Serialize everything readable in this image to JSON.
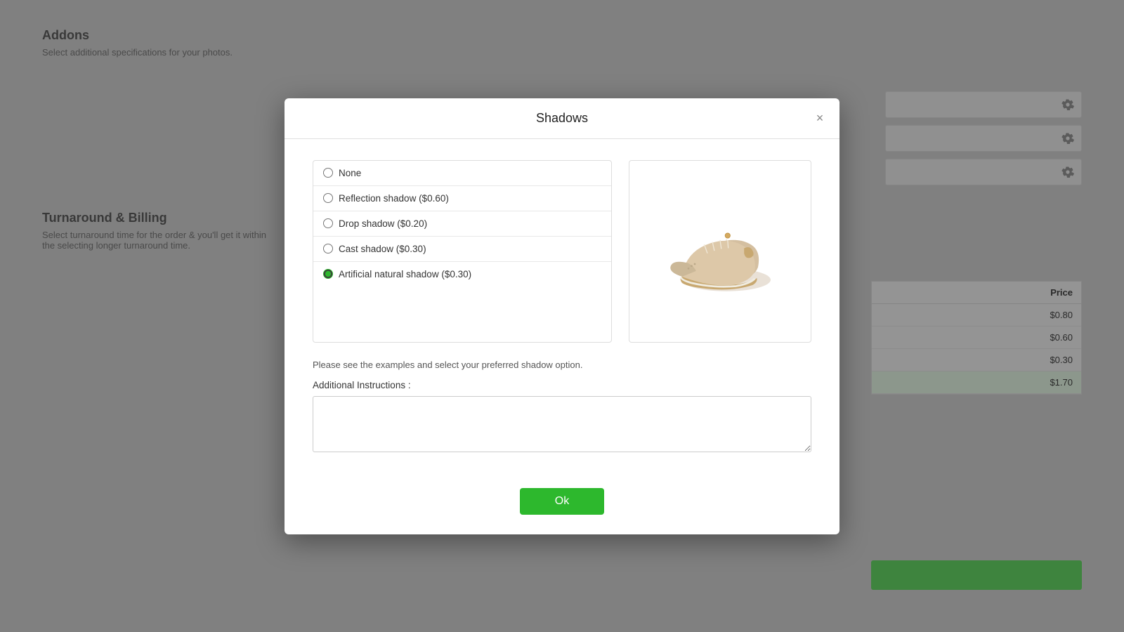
{
  "background": {
    "addons_title": "Addons",
    "addons_desc": "Select additional specifications for your photos.",
    "turnaround_title": "Turnaround & Billing",
    "turnaround_desc": "Select turnaround time for the order & you'll get it within the selecting longer turnaround time.",
    "table": {
      "header_price": "Price",
      "rows": [
        {
          "price": "$0.80"
        },
        {
          "price": "$0.60"
        },
        {
          "price": "$0.30"
        },
        {
          "price": "$1.70",
          "highlighted": true
        }
      ]
    }
  },
  "modal": {
    "title": "Shadows",
    "close_label": "×",
    "options": [
      {
        "id": "none",
        "label": "None",
        "selected": false
      },
      {
        "id": "reflection",
        "label": "Reflection shadow ($0.60)",
        "selected": false
      },
      {
        "id": "drop",
        "label": "Drop shadow ($0.20)",
        "selected": false
      },
      {
        "id": "cast",
        "label": "Cast shadow ($0.30)",
        "selected": false
      },
      {
        "id": "artificial",
        "label": "Artificial natural shadow ($0.30)",
        "selected": true
      }
    ],
    "instruction_text": "Please see the examples and select your preferred shadow option.",
    "additional_label": "Additional Instructions :",
    "additional_placeholder": "",
    "ok_label": "Ok"
  }
}
